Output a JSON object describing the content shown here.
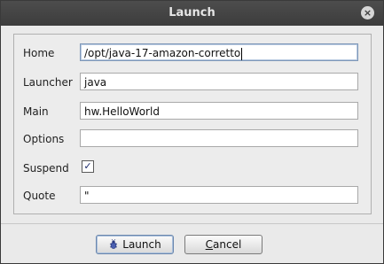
{
  "window": {
    "title": "Launch",
    "close_icon": "×"
  },
  "form": {
    "home": {
      "label": "Home",
      "value": "/opt/java-17-amazon-corretto"
    },
    "launcher": {
      "label": "Launcher",
      "value": "java"
    },
    "main": {
      "label": "Main",
      "value": "hw.HelloWorld"
    },
    "options": {
      "label": "Options",
      "value": ""
    },
    "suspend": {
      "label": "Suspend",
      "checked": true,
      "check_glyph": "✓"
    },
    "quote": {
      "label": "Quote",
      "value": "\""
    }
  },
  "buttons": {
    "launch": {
      "label": "Launch",
      "icon": "bug-icon"
    },
    "cancel": {
      "label_first": "C",
      "label_rest": "ancel"
    }
  }
}
